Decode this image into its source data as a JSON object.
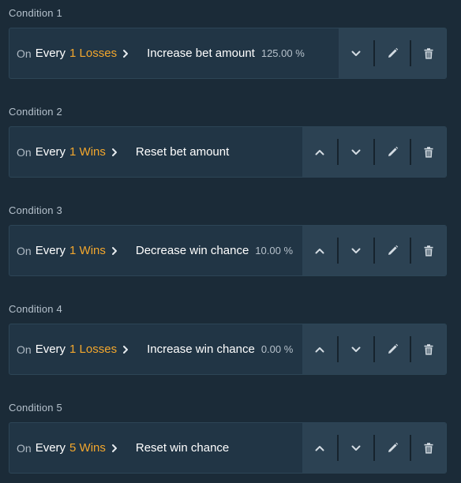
{
  "conditions": [
    {
      "title": "Condition 1",
      "on": "On",
      "every": "Every",
      "count": "1 Losses",
      "action": "Increase bet amount",
      "value": "125.00 %",
      "buttons": [
        "down",
        "edit",
        "delete"
      ]
    },
    {
      "title": "Condition 2",
      "on": "On",
      "every": "Every",
      "count": "1 Wins",
      "action": "Reset bet amount",
      "value": "",
      "buttons": [
        "up",
        "down",
        "edit",
        "delete"
      ]
    },
    {
      "title": "Condition 3",
      "on": "On",
      "every": "Every",
      "count": "1 Wins",
      "action": "Decrease win chance",
      "value": "10.00 %",
      "buttons": [
        "up",
        "down",
        "edit",
        "delete"
      ]
    },
    {
      "title": "Condition 4",
      "on": "On",
      "every": "Every",
      "count": "1 Losses",
      "action": "Increase win chance",
      "value": "0.00 %",
      "buttons": [
        "up",
        "down",
        "edit",
        "delete"
      ]
    },
    {
      "title": "Condition 5",
      "on": "On",
      "every": "Every",
      "count": "5 Wins",
      "action": "Reset win chance",
      "value": "",
      "buttons": [
        "up",
        "down",
        "edit",
        "delete"
      ]
    }
  ],
  "icons": {
    "up": "chevron-up-icon",
    "down": "chevron-down-icon",
    "edit": "pencil-icon",
    "delete": "trash-icon",
    "arrow": "chevron-right-icon"
  },
  "colors": {
    "background": "#1b2b38",
    "card": "#213545",
    "button_panel": "#2c4253",
    "accent": "#f3a72d",
    "text": "#ffffff",
    "muted_text": "#aeb9c3"
  }
}
